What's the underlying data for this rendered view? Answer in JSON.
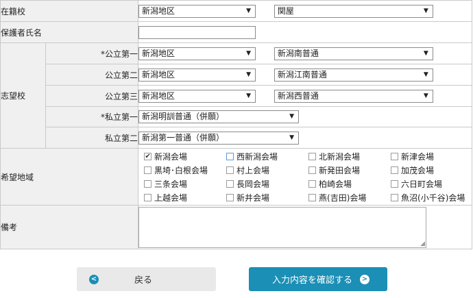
{
  "form": {
    "current_school": {
      "label": "在籍校",
      "area": "新潟地区",
      "school": "関屋"
    },
    "guardian": {
      "label": "保護者氏名",
      "value": ""
    },
    "preferences": {
      "label": "志望校",
      "rows": [
        {
          "label": "*公立第一",
          "area": "新潟地区",
          "school": "新潟南普通"
        },
        {
          "label": "公立第二",
          "area": "新潟地区",
          "school": "新潟江南普通"
        },
        {
          "label": "公立第三",
          "area": "新潟地区",
          "school": "新潟西普通"
        },
        {
          "label": "*私立第一",
          "school": "新潟明訓普通（併願）"
        },
        {
          "label": "私立第二",
          "school": "新潟第一普通（併願）"
        }
      ]
    },
    "venues": {
      "label": "希望地域",
      "items": [
        {
          "label": "新潟会場",
          "checked": true
        },
        {
          "label": "西新潟会場",
          "checked": false
        },
        {
          "label": "北新潟会場",
          "checked": false
        },
        {
          "label": "新津会場",
          "checked": false
        },
        {
          "label": "黒埼･白根会場",
          "checked": false
        },
        {
          "label": "村上会場",
          "checked": false
        },
        {
          "label": "新発田会場",
          "checked": false
        },
        {
          "label": "加茂会場",
          "checked": false
        },
        {
          "label": "三条会場",
          "checked": false
        },
        {
          "label": "長岡会場",
          "checked": false
        },
        {
          "label": "柏崎会場",
          "checked": false
        },
        {
          "label": "六日町会場",
          "checked": false
        },
        {
          "label": "上越会場",
          "checked": false
        },
        {
          "label": "新井会場",
          "checked": false
        },
        {
          "label": "燕(吉田)会場",
          "checked": false
        },
        {
          "label": "魚沼(小千谷)会場",
          "checked": false
        }
      ]
    },
    "remarks": {
      "label": "備考",
      "value": ""
    }
  },
  "buttons": {
    "back": "戻る",
    "confirm": "入力内容を確認する"
  },
  "icons": {
    "dropdown": "dropdown-arrow-icon",
    "back": "chevron-left-circle-icon",
    "confirm": "chevron-right-circle-icon",
    "resize": "resize-grip-icon"
  },
  "colors": {
    "accent": "#1b8fb5",
    "label_bg": "#f0f0f0",
    "border": "#c9c9c9"
  }
}
